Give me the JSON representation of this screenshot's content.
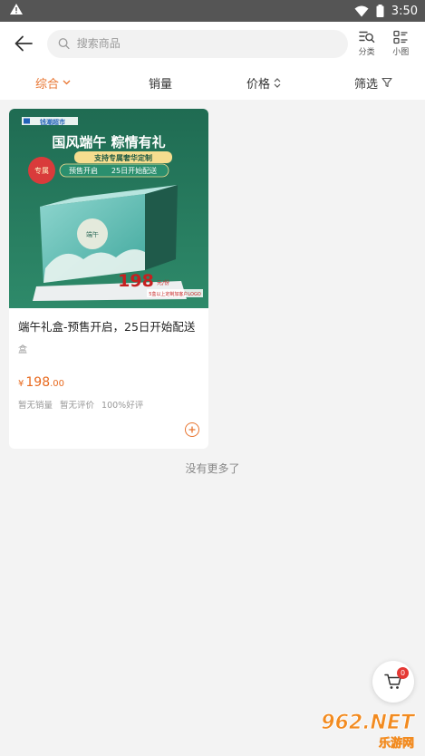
{
  "status_bar": {
    "time": "3:50"
  },
  "search": {
    "placeholder": "搜索商品"
  },
  "header": {
    "category_label": "分类",
    "view_label": "小图"
  },
  "tabs": [
    {
      "label": "综合",
      "active": true
    },
    {
      "label": "销量"
    },
    {
      "label": "价格"
    },
    {
      "label": "筛选"
    }
  ],
  "product": {
    "title": "端午礼盒-预售开启，25日开始配送",
    "unit": "盒",
    "currency": "¥",
    "price_int": "198",
    "price_dec": ".00",
    "sales": "暂无销量",
    "reviews": "暂无评价",
    "rating": "100%好评",
    "image": {
      "brand": "钱潮超市",
      "headline": "国风端午 粽情有礼",
      "subline": "支持专属奢华定制",
      "seal": "专属",
      "presale": "预售开启",
      "delivery": "25日开始配送",
      "box_text": "端午",
      "price": "198",
      "price_unit": "元/份",
      "note": "5盒以上定制加客户LOGO"
    }
  },
  "footer": {
    "no_more": "没有更多了"
  },
  "cart": {
    "count": "0"
  },
  "watermark": {
    "text": "962.NET",
    "subtext": "乐游网"
  },
  "colors": {
    "accent": "#e8742f",
    "price": "#e86a1f",
    "status_bar": "#555555",
    "banner": "#1f6b52"
  }
}
